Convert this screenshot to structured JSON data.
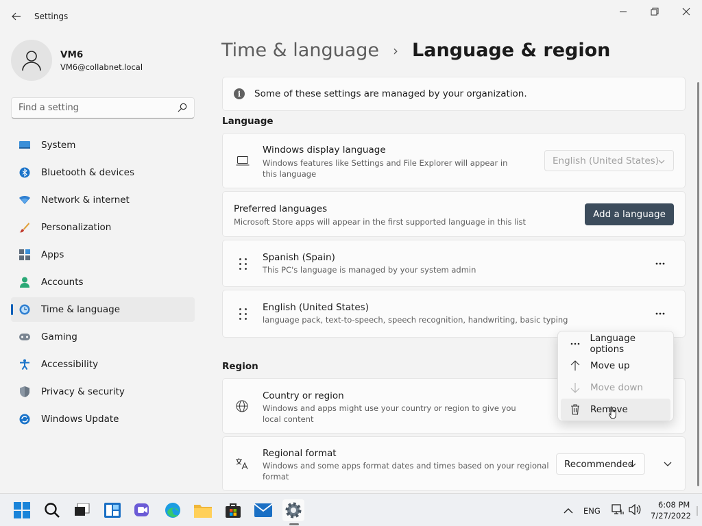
{
  "window": {
    "title": "Settings"
  },
  "user": {
    "name": "VM6",
    "email": "VM6@collabnet.local"
  },
  "search": {
    "placeholder": "Find a setting"
  },
  "sidebar": {
    "items": [
      {
        "label": "System",
        "icon": "system-icon"
      },
      {
        "label": "Bluetooth & devices",
        "icon": "bluetooth-icon"
      },
      {
        "label": "Network & internet",
        "icon": "network-icon"
      },
      {
        "label": "Personalization",
        "icon": "brush-icon"
      },
      {
        "label": "Apps",
        "icon": "apps-icon"
      },
      {
        "label": "Accounts",
        "icon": "accounts-icon"
      },
      {
        "label": "Time & language",
        "icon": "time-language-icon",
        "active": true
      },
      {
        "label": "Gaming",
        "icon": "gaming-icon"
      },
      {
        "label": "Accessibility",
        "icon": "accessibility-icon"
      },
      {
        "label": "Privacy & security",
        "icon": "shield-icon"
      },
      {
        "label": "Windows Update",
        "icon": "update-icon"
      }
    ]
  },
  "breadcrumb": {
    "parent": "Time & language",
    "separator": "›",
    "current": "Language & region"
  },
  "info_banner": {
    "text": "Some of these settings are managed by your organization."
  },
  "language": {
    "section_label": "Language",
    "display_language": {
      "title": "Windows display language",
      "subtitle": "Windows features like Settings and File Explorer will appear in this language",
      "value": "English (United States)"
    },
    "preferred": {
      "title": "Preferred languages",
      "subtitle": "Microsoft Store apps will appear in the first supported language in this list",
      "add_button": "Add a language"
    },
    "languages": [
      {
        "name": "Spanish (Spain)",
        "detail": "This PC's language is managed by your system admin"
      },
      {
        "name": "English (United States)",
        "detail": "language pack, text-to-speech, speech recognition, handwriting, basic typing"
      }
    ]
  },
  "region": {
    "section_label": "Region",
    "country": {
      "title": "Country or region",
      "subtitle": "Windows and apps might use your country or region to give you local content"
    },
    "format": {
      "title": "Regional format",
      "subtitle": "Windows and some apps format dates and times based on your regional format",
      "value": "Recommended"
    }
  },
  "context_menu": {
    "items": [
      {
        "label": "Language options",
        "icon": "more-icon",
        "disabled": false
      },
      {
        "label": "Move up",
        "icon": "arrow-up-icon",
        "disabled": false
      },
      {
        "label": "Move down",
        "icon": "arrow-down-icon",
        "disabled": true
      },
      {
        "label": "Remove",
        "icon": "trash-icon",
        "disabled": false
      }
    ]
  },
  "taskbar": {
    "language": "ENG",
    "time": "6:08 PM",
    "date": "7/27/2022"
  },
  "colors": {
    "accent": "#005fb8",
    "primary_button": "#3c4c5c"
  }
}
